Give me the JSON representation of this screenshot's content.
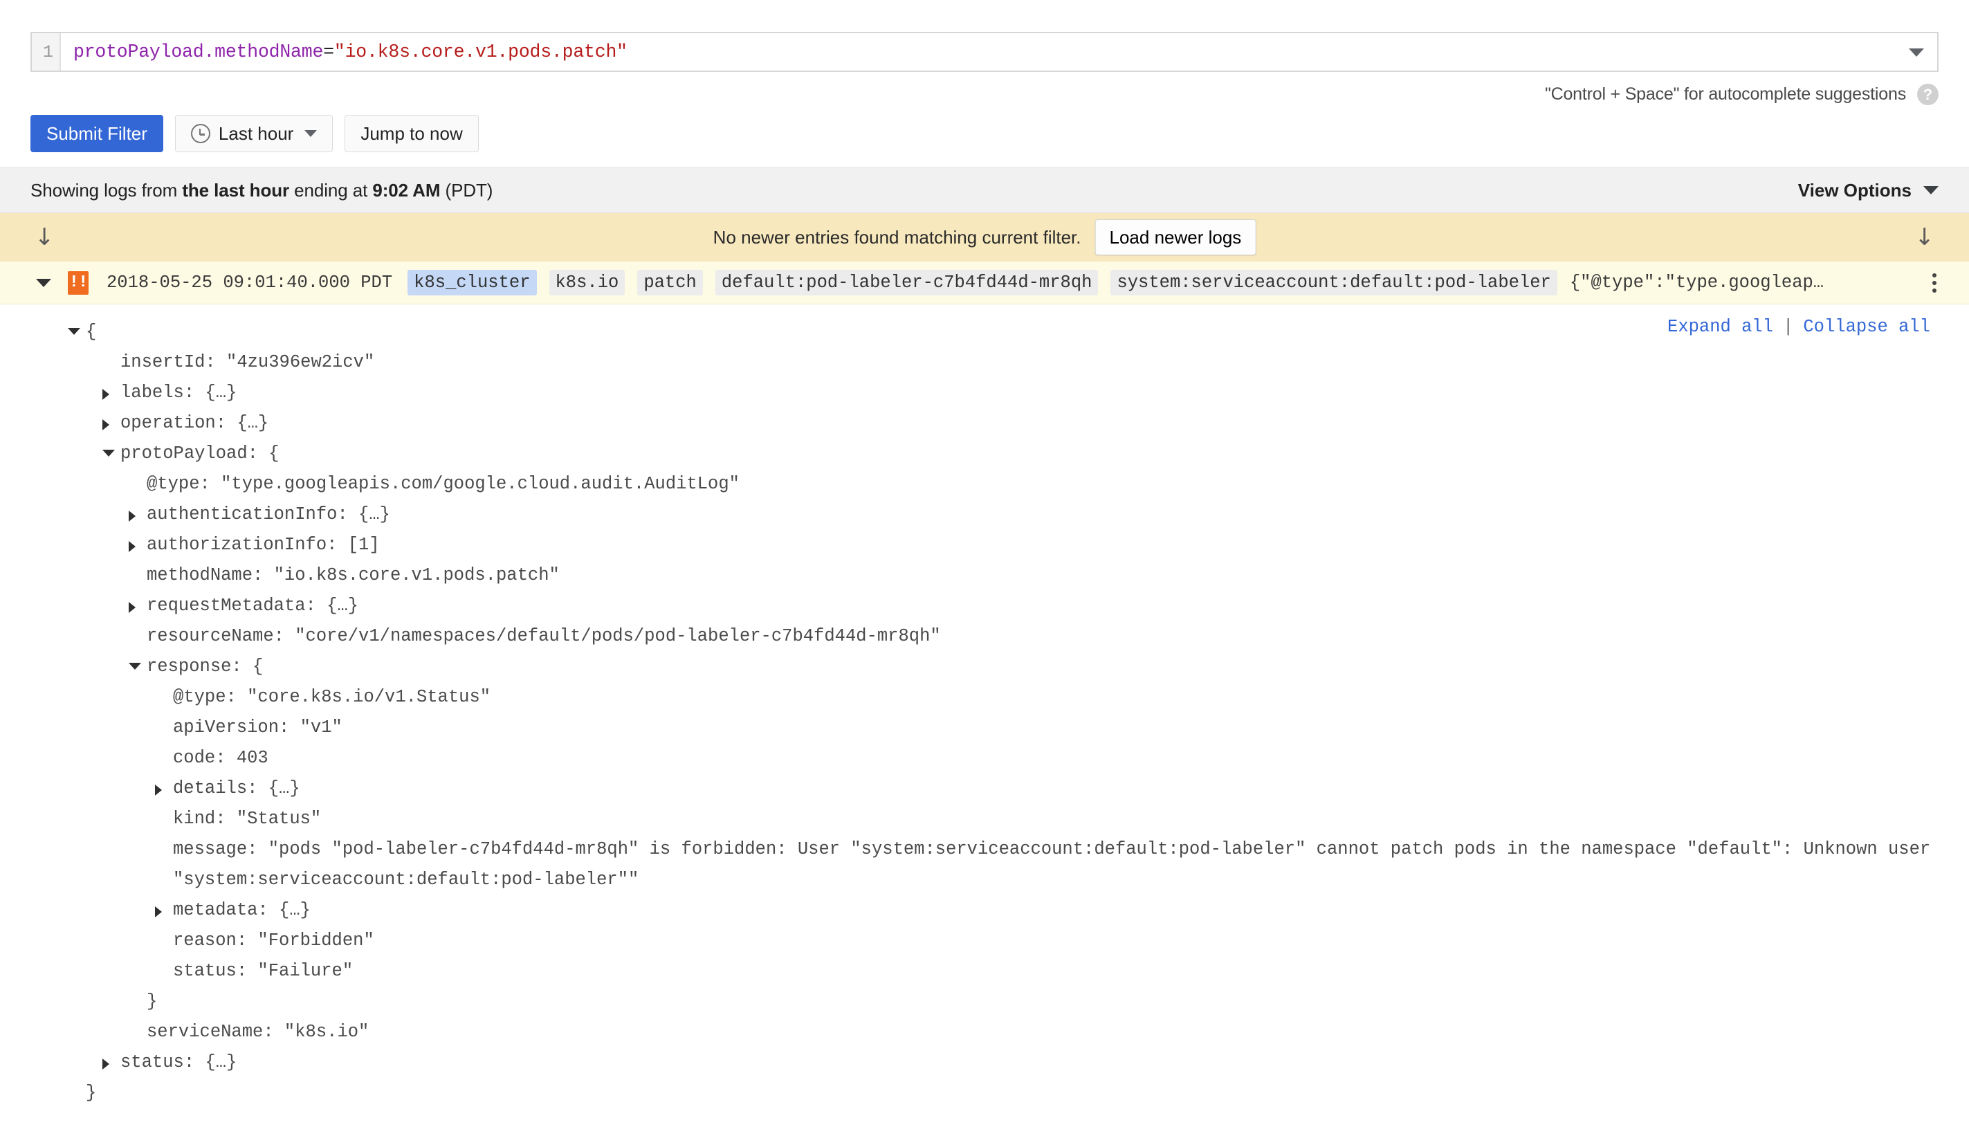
{
  "filter": {
    "line_number": "1",
    "query_field": "protoPayload.methodName",
    "query_operator": "=",
    "query_value": "\"io.k8s.core.v1.pods.patch\"",
    "dropdown_icon": "chevron-down-icon"
  },
  "hint": {
    "text": "\"Control + Space\" for autocomplete suggestions",
    "help_icon": "?"
  },
  "toolbar": {
    "submit_label": "Submit Filter",
    "time_range_label": "Last hour",
    "jump_label": "Jump to now"
  },
  "status_bar": {
    "prefix": "Showing logs from ",
    "range": "the last hour",
    "middle": " ending at ",
    "time": "9:02 AM",
    "suffix": " (PDT)",
    "view_options_label": "View Options"
  },
  "banner": {
    "message": "No newer entries found matching current filter.",
    "load_button": "Load newer logs",
    "arrow_glyph": "↓"
  },
  "entry": {
    "timestamp": "2018-05-25 09:01:40.000 PDT",
    "chips": [
      {
        "label": "k8s_cluster",
        "selected": true
      },
      {
        "label": "k8s.io",
        "selected": false
      },
      {
        "label": "patch",
        "selected": false
      },
      {
        "label": "default:pod-labeler-c7b4fd44d-mr8qh",
        "selected": false
      },
      {
        "label": "system:serviceaccount:default:pod-labeler",
        "selected": false
      }
    ],
    "summary": "{\"@type\":\"type.googleap…",
    "severity": "!!"
  },
  "tree": {
    "expand_all": "Expand all",
    "separator": "|",
    "collapse_all": "Collapse all",
    "lines": [
      {
        "indent": 0,
        "tri": "open",
        "text": "{"
      },
      {
        "indent": 1,
        "tri": "none",
        "text": "insertId: \"4zu396ew2icv\""
      },
      {
        "indent": 1,
        "tri": "closed",
        "text": "labels: {…}"
      },
      {
        "indent": 1,
        "tri": "closed",
        "text": "operation: {…}"
      },
      {
        "indent": 1,
        "tri": "open",
        "text": "protoPayload: {"
      },
      {
        "indent": 2,
        "tri": "none",
        "text": "@type: \"type.googleapis.com/google.cloud.audit.AuditLog\""
      },
      {
        "indent": 2,
        "tri": "closed",
        "text": "authenticationInfo: {…}"
      },
      {
        "indent": 2,
        "tri": "closed",
        "text": "authorizationInfo: [1]"
      },
      {
        "indent": 2,
        "tri": "none",
        "text": "methodName: \"io.k8s.core.v1.pods.patch\""
      },
      {
        "indent": 2,
        "tri": "closed",
        "text": "requestMetadata: {…}"
      },
      {
        "indent": 2,
        "tri": "none",
        "text": "resourceName: \"core/v1/namespaces/default/pods/pod-labeler-c7b4fd44d-mr8qh\""
      },
      {
        "indent": 2,
        "tri": "open",
        "text": "response: {"
      },
      {
        "indent": 3,
        "tri": "none",
        "text": "@type: \"core.k8s.io/v1.Status\""
      },
      {
        "indent": 3,
        "tri": "none",
        "text": "apiVersion: \"v1\""
      },
      {
        "indent": 3,
        "tri": "none",
        "text": "code: 403"
      },
      {
        "indent": 3,
        "tri": "closed",
        "text": "details: {…}"
      },
      {
        "indent": 3,
        "tri": "none",
        "text": "kind: \"Status\""
      },
      {
        "indent": 3,
        "tri": "none",
        "wrap": true,
        "text": "message: \"pods \"pod-labeler-c7b4fd44d-mr8qh\" is forbidden: User \"system:serviceaccount:default:pod-labeler\" cannot patch pods in the namespace \"default\": Unknown user \"system:serviceaccount:default:pod-labeler\"\""
      },
      {
        "indent": 3,
        "tri": "closed",
        "text": "metadata: {…}"
      },
      {
        "indent": 3,
        "tri": "none",
        "text": "reason: \"Forbidden\""
      },
      {
        "indent": 3,
        "tri": "none",
        "text": "status: \"Failure\""
      },
      {
        "indent": 2,
        "tri": "none",
        "text": "}"
      },
      {
        "indent": 2,
        "tri": "none",
        "text": "serviceName: \"k8s.io\""
      },
      {
        "indent": 1,
        "tri": "closed",
        "text": "status: {…}"
      },
      {
        "indent": 0,
        "tri": "none",
        "text": "}"
      }
    ]
  },
  "colors": {
    "accent": "#3367d6",
    "banner_bg": "#f7e8bd",
    "entry_bg": "#fdfbe4",
    "severity_warning": "#ef6c20",
    "chip_selected": "#c5d9f7",
    "query_field": "#8e24aa",
    "query_string": "#b71c1c"
  }
}
